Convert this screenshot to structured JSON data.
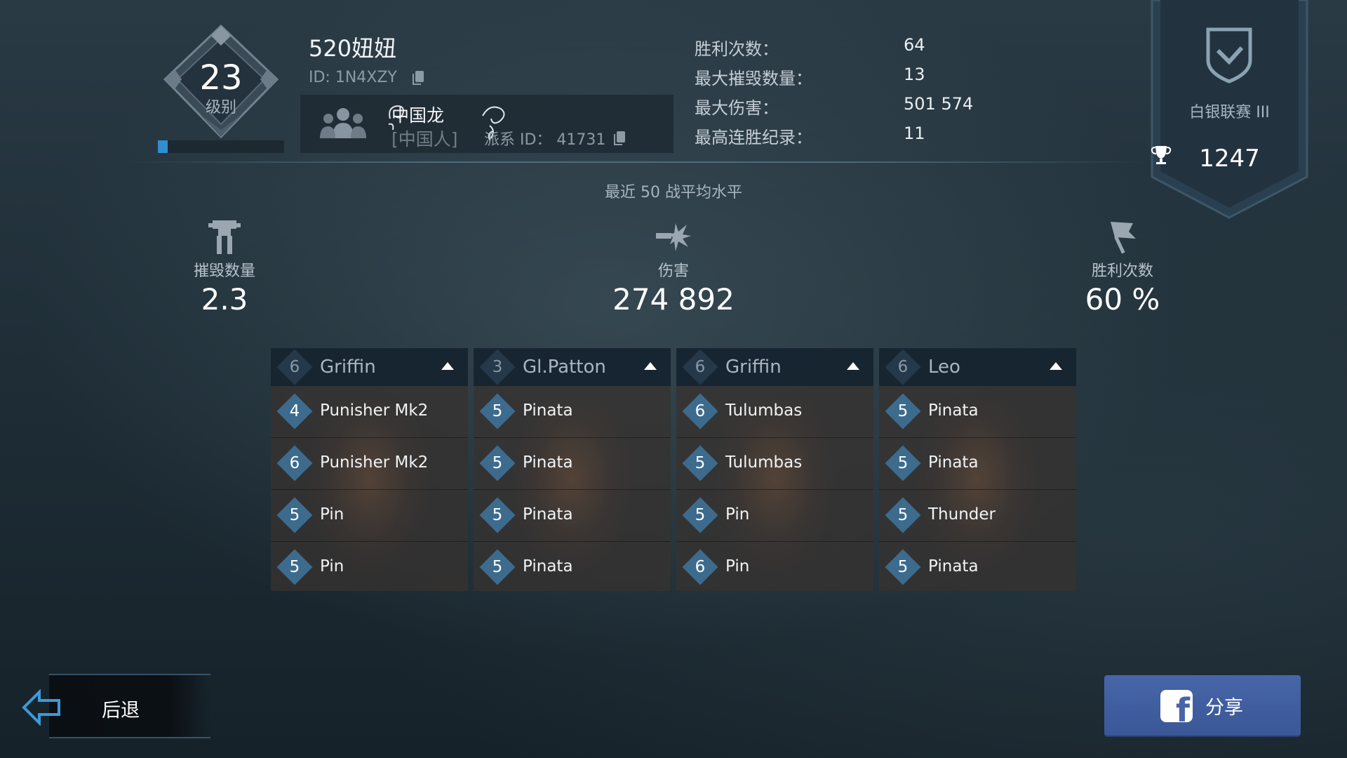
{
  "level": {
    "number": "23",
    "label": "级别",
    "progress": 0.08
  },
  "player": {
    "name": "520妞妞",
    "id": "ID: 1N4XZY"
  },
  "clan": {
    "name": "中国龙",
    "tag": "[中国人]",
    "id": "派系 ID： 41731"
  },
  "stats": [
    {
      "label": "胜利次数：",
      "value": "64"
    },
    {
      "label": "最大摧毁数量：",
      "value": "13"
    },
    {
      "label": "最大伤害：",
      "value": "501 574"
    },
    {
      "label": "最高连胜纪录：",
      "value": "11"
    }
  ],
  "league": {
    "name": "白银联赛 III",
    "trophies": "1247"
  },
  "averages": {
    "title": "最近 50 战平均水平",
    "kills": {
      "label": "摧毁数量",
      "value": "2.3"
    },
    "damage": {
      "label": "伤害",
      "value": "274 892"
    },
    "wins": {
      "label": "胜利次数",
      "value": "60 %"
    }
  },
  "loadout": [
    {
      "level": "6",
      "robot": "Griffin",
      "weapons": [
        {
          "level": "4",
          "name": "Punisher Mk2"
        },
        {
          "level": "6",
          "name": "Punisher Mk2"
        },
        {
          "level": "5",
          "name": "Pin"
        },
        {
          "level": "5",
          "name": "Pin"
        }
      ]
    },
    {
      "level": "3",
      "robot": "Gl.Patton",
      "weapons": [
        {
          "level": "5",
          "name": "Pinata"
        },
        {
          "level": "5",
          "name": "Pinata"
        },
        {
          "level": "5",
          "name": "Pinata"
        },
        {
          "level": "5",
          "name": "Pinata"
        }
      ]
    },
    {
      "level": "6",
      "robot": "Griffin",
      "weapons": [
        {
          "level": "6",
          "name": "Tulumbas"
        },
        {
          "level": "5",
          "name": "Tulumbas"
        },
        {
          "level": "5",
          "name": "Pin"
        },
        {
          "level": "6",
          "name": "Pin"
        }
      ]
    },
    {
      "level": "6",
      "robot": "Leo",
      "weapons": [
        {
          "level": "5",
          "name": "Pinata"
        },
        {
          "level": "5",
          "name": "Pinata"
        },
        {
          "level": "5",
          "name": "Thunder"
        },
        {
          "level": "5",
          "name": "Pinata"
        }
      ]
    }
  ],
  "buttons": {
    "back": "后退",
    "share": "分享"
  },
  "colors": {
    "accent": "#2f8fd0",
    "facebook": "#4766a8",
    "diamond": "#3d6b8e"
  },
  "icons": [
    "copy-icon",
    "people-icon",
    "trophy-icon",
    "shield-check-icon",
    "mech-icon",
    "explosion-icon",
    "flag-icon",
    "back-arrow-icon",
    "facebook-icon"
  ]
}
